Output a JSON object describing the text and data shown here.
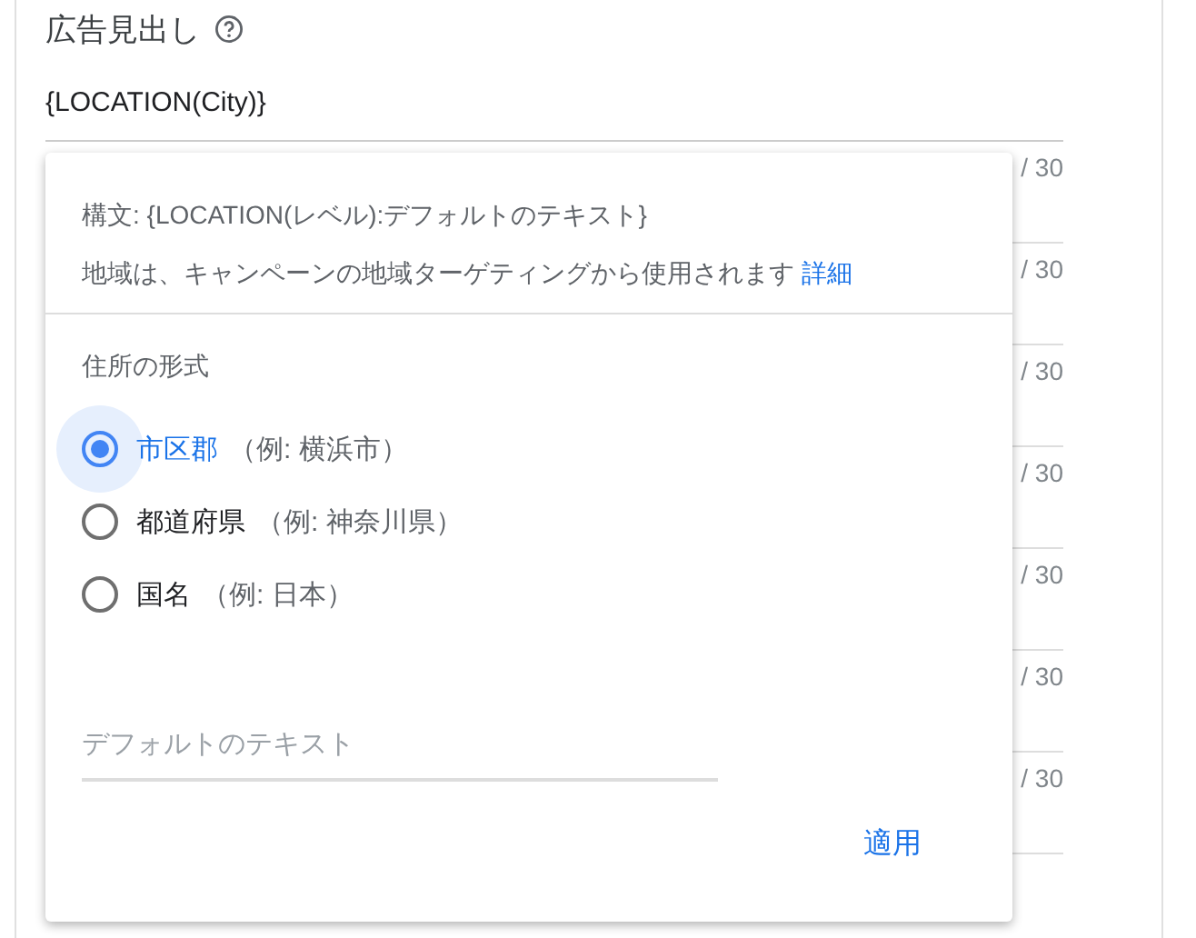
{
  "heading": {
    "title": "広告見出し"
  },
  "headline_field": {
    "value": "{LOCATION(City)}"
  },
  "counters": [
    "/ 30",
    "/ 30",
    "/ 30",
    "/ 30",
    "/ 30",
    "/ 30",
    "/ 30"
  ],
  "popup": {
    "syntax": "構文: {LOCATION(レベル):デフォルトのテキスト}",
    "description": "地域は、キャンペーンの地域ターゲティングから使用されます",
    "link": "詳細",
    "section_label": "住所の形式",
    "options": [
      {
        "label": "市区郡",
        "example": "（例: 横浜市）",
        "selected": true
      },
      {
        "label": "都道府県",
        "example": "（例: 神奈川県）",
        "selected": false
      },
      {
        "label": "国名",
        "example": "（例: 日本）",
        "selected": false
      }
    ],
    "default_field": {
      "placeholder": "デフォルトのテキスト"
    },
    "apply": "適用"
  }
}
